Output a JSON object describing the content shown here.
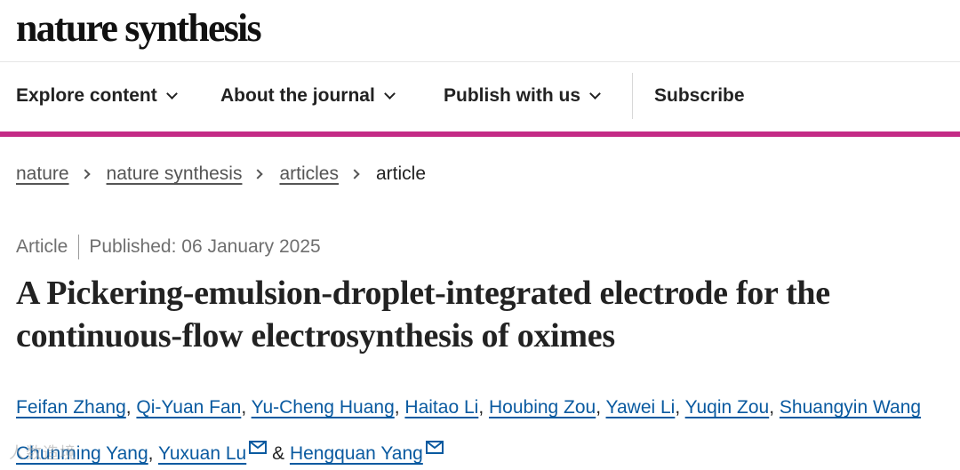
{
  "header": {
    "logo": "nature synthesis"
  },
  "nav": {
    "explore": "Explore content",
    "about": "About the journal",
    "publish": "Publish with us",
    "subscribe": "Subscribe"
  },
  "breadcrumb": {
    "items": [
      "nature",
      "nature synthesis",
      "articles"
    ],
    "current": "article"
  },
  "article": {
    "type": "Article",
    "published": "Published: 06 January 2025",
    "title": "A Pickering-emulsion-droplet-integrated electrode for the continuous-flow electrosynthesis of oximes",
    "authors": [
      "Feifan Zhang",
      "Qi-Yuan Fan",
      "Yu-Cheng Huang",
      "Haitao Li",
      "Houbing Zou",
      "Yawei Li",
      "Yuqin Zou",
      "Shuangyin Wang",
      "Chunming Yang",
      "Yuxuan Lu",
      "Hengquan Yang"
    ],
    "author_joiner": "&"
  },
  "watermark": "人数造境",
  "colors": {
    "accent": "#c42b86",
    "link": "#0a5aa0"
  }
}
